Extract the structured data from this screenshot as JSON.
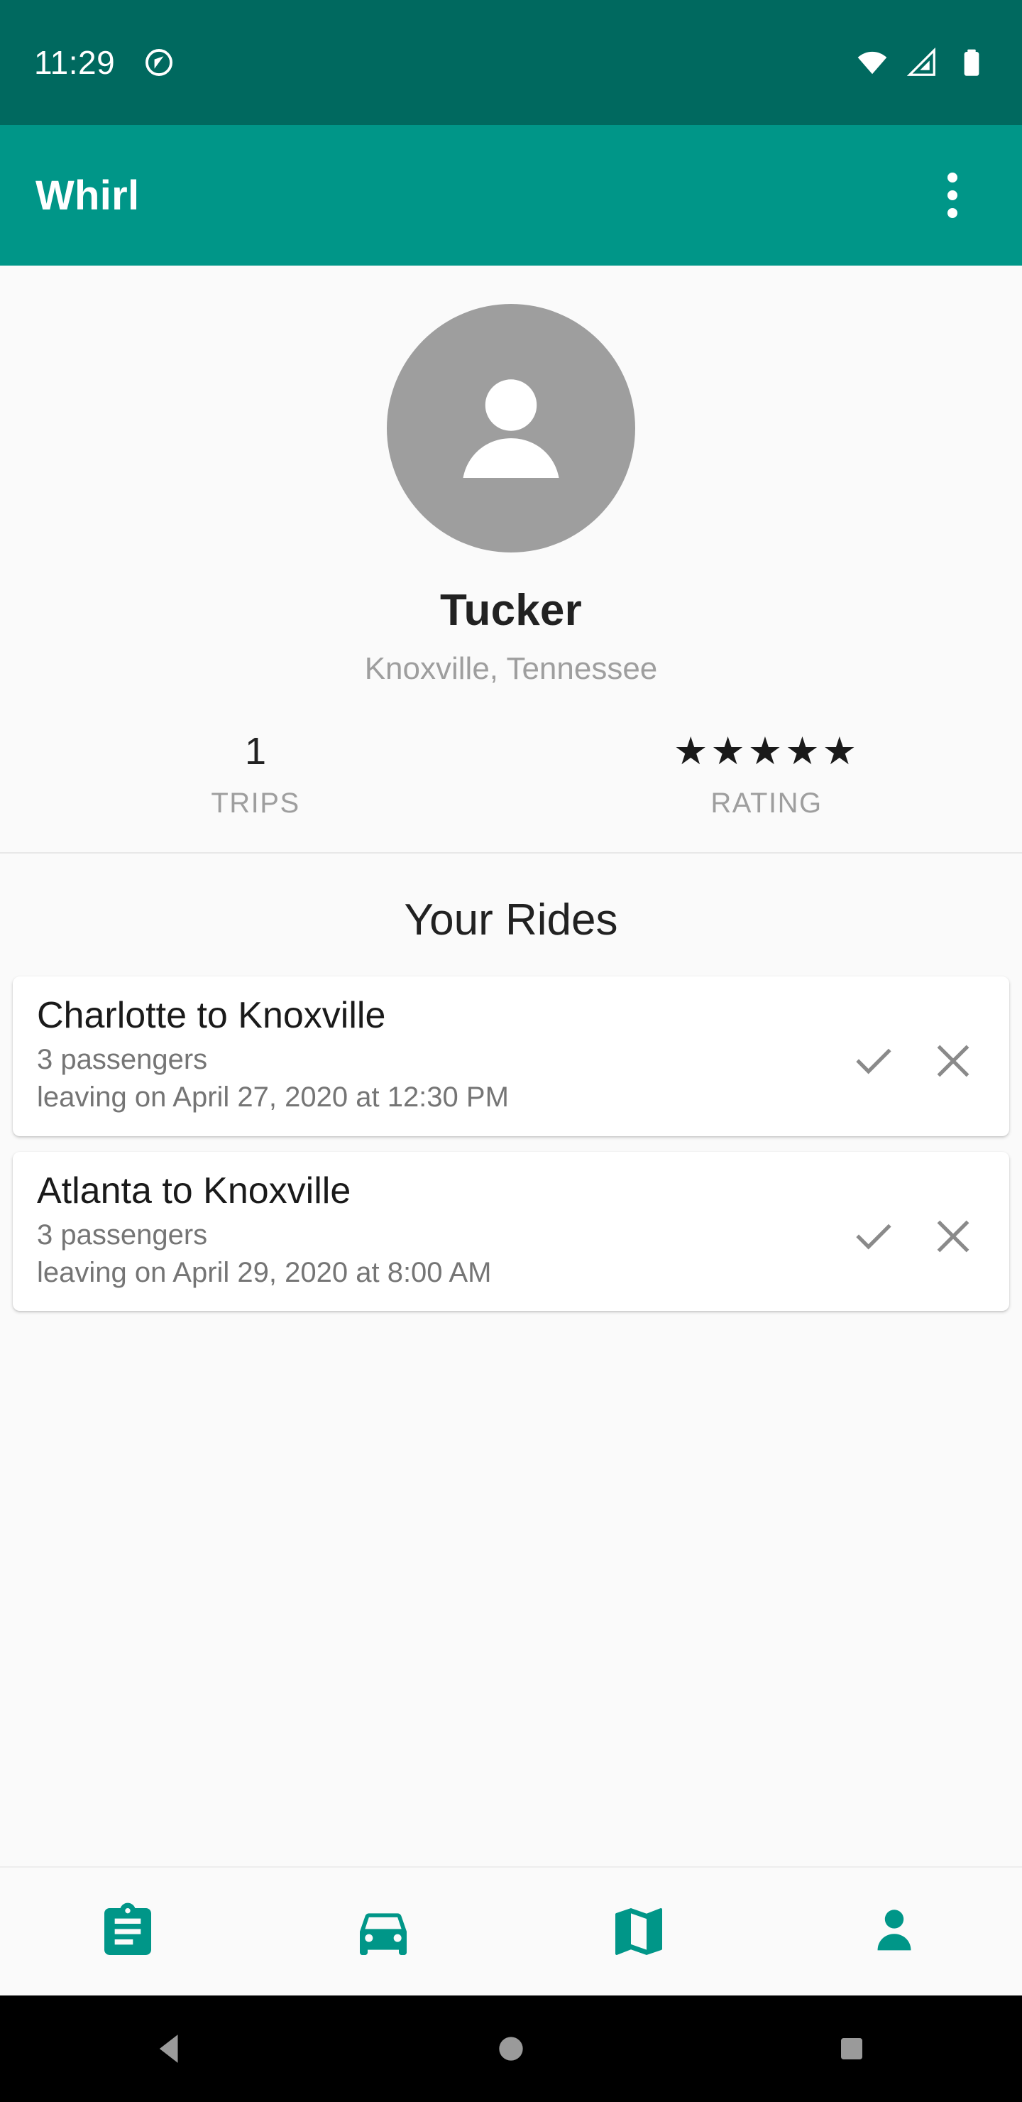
{
  "status_bar": {
    "time": "11:29",
    "icons": [
      "do-not-disturb-icon",
      "wifi-icon",
      "cellular-signal-icon",
      "battery-icon"
    ]
  },
  "app_bar": {
    "title": "Whirl",
    "overflow_label": "more-options"
  },
  "profile": {
    "avatar_alt": "default-avatar",
    "name": "Tucker",
    "location": "Knoxville, Tennessee",
    "stats": [
      {
        "value": "1",
        "label": "TRIPS",
        "type": "number"
      },
      {
        "value": "★★★★★",
        "label": "RATING",
        "type": "stars",
        "stars": 5
      }
    ]
  },
  "rides": {
    "section_title": "Your Rides",
    "items": [
      {
        "route": "Charlotte to Knoxville",
        "passengers": "3 passengers",
        "departure": "leaving on April 27, 2020 at 12:30 PM",
        "accept_label": "accept",
        "decline_label": "decline"
      },
      {
        "route": "Atlanta to Knoxville",
        "passengers": "3 passengers",
        "departure": "leaving on April 29, 2020 at 8:00 AM",
        "accept_label": "accept",
        "decline_label": "decline"
      }
    ]
  },
  "bottom_nav": {
    "items": [
      {
        "icon": "clipboard-icon",
        "name": "trips"
      },
      {
        "icon": "car-icon",
        "name": "rides"
      },
      {
        "icon": "map-icon",
        "name": "map"
      },
      {
        "icon": "person-icon",
        "name": "profile"
      }
    ]
  },
  "system_nav": {
    "items": [
      {
        "name": "back-button",
        "icon": "triangle-left-icon"
      },
      {
        "name": "home-button",
        "icon": "circle-icon"
      },
      {
        "name": "recents-button",
        "icon": "square-icon"
      }
    ]
  },
  "colors": {
    "status_bar": "#00695f",
    "app_bar": "#009688",
    "accent": "#009688",
    "page_bg": "#fafafa",
    "card_bg": "#ffffff",
    "text_primary": "#212121",
    "text_secondary": "#9e9e9e",
    "icon_gray": "#8a8a8a",
    "avatar_bg": "#9e9e9e",
    "sys_nav_bg": "#000000",
    "sys_icon": "#9a9a9a"
  }
}
